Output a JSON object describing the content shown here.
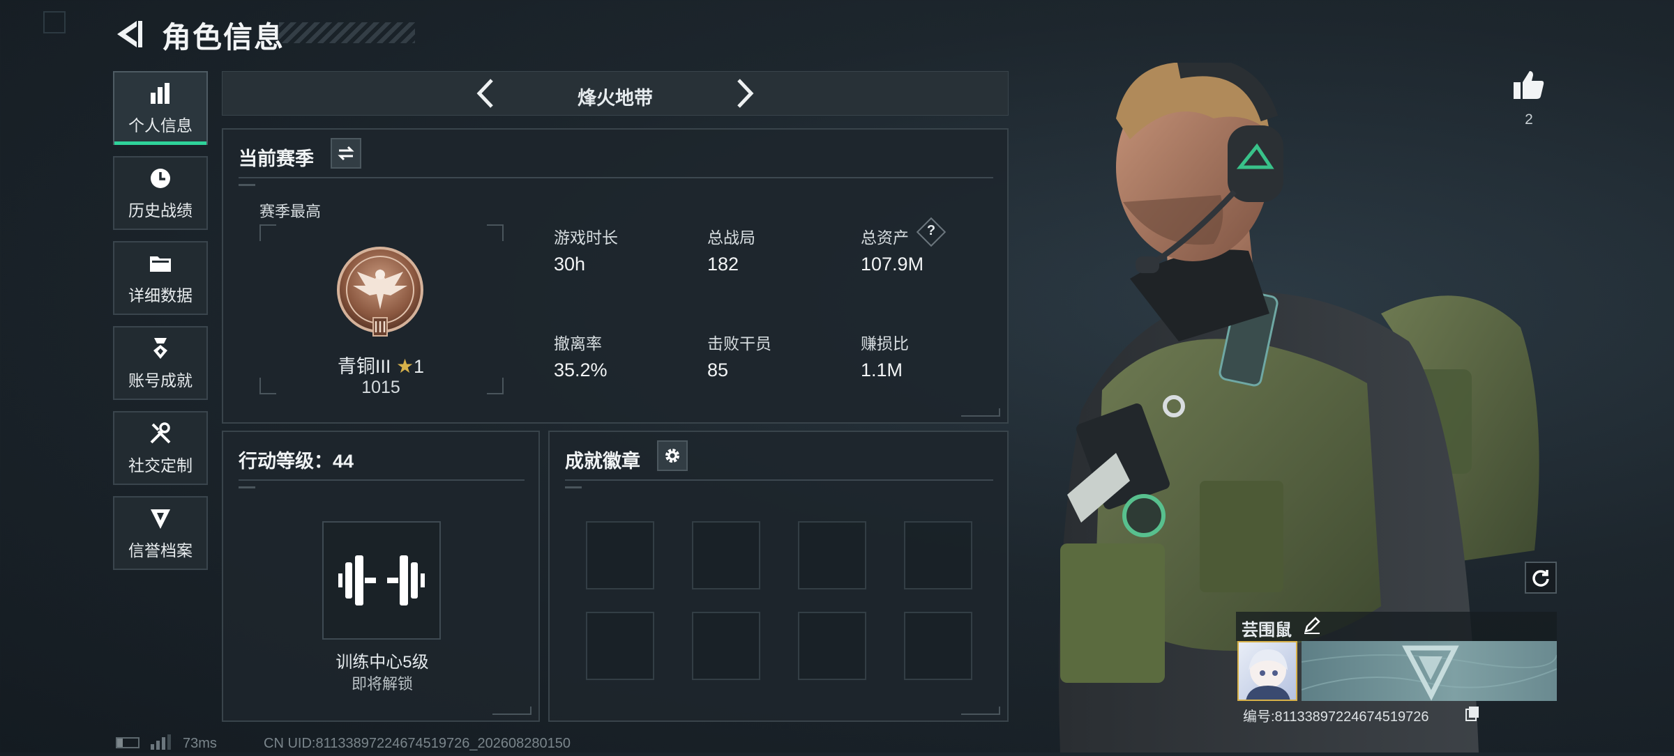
{
  "header": {
    "title": "角色信息"
  },
  "sidebar": {
    "items": [
      {
        "label": "个人信息",
        "icon": "bar-chart-icon",
        "active": true
      },
      {
        "label": "历史战绩",
        "icon": "history-clock-icon",
        "active": false
      },
      {
        "label": "详细数据",
        "icon": "folder-icon",
        "active": false
      },
      {
        "label": "账号成就",
        "icon": "medal-icon",
        "active": false
      },
      {
        "label": "社交定制",
        "icon": "tools-icon",
        "active": false
      },
      {
        "label": "信誉档案",
        "icon": "shield-badge-icon",
        "active": false
      }
    ]
  },
  "mode": {
    "title": "烽火地带"
  },
  "season": {
    "title": "当前赛季",
    "best_label": "赛季最高",
    "rank_name": "青铜III",
    "rank_stars": "1",
    "rank_points": "1015",
    "stats": [
      {
        "label": "游戏时长",
        "value": "30h"
      },
      {
        "label": "总战局",
        "value": "182"
      },
      {
        "label": "总资产",
        "value": "107.9M",
        "help": "?"
      },
      {
        "label": "撤离率",
        "value": "35.2%"
      },
      {
        "label": "击败干员",
        "value": "85"
      },
      {
        "label": "赚损比",
        "value": "1.1M"
      }
    ]
  },
  "level": {
    "title": "行动等级：44",
    "center_name": "训练中心5级",
    "center_status": "即将解锁"
  },
  "achievements": {
    "title": "成就徽章",
    "slots": 8
  },
  "profile": {
    "likes": "2",
    "player_name": "芸围鼠",
    "id_line": "编号:81133897224674519726"
  },
  "status_bar": {
    "ping": "73ms",
    "uid_line": "CN UID:81133897224674519726_202608280150"
  },
  "colors": {
    "accent": "#2fd39a",
    "panel_border": "#39444b",
    "rank_bronze": "#a26c52"
  }
}
